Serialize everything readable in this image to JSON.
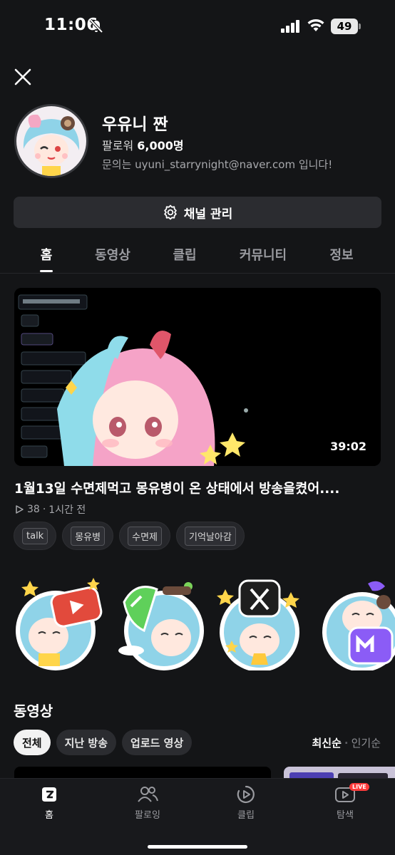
{
  "status_bar": {
    "time": "11:06",
    "battery": "49"
  },
  "channel": {
    "name": "우유니 짠",
    "followers_label": "팔로워",
    "followers_count": "6,000명",
    "inquiry": "문의는 uyuni_starrynight@naver.com 입니다!",
    "manage_button": "채널 관리"
  },
  "tabs": [
    {
      "label": "홈",
      "active": true
    },
    {
      "label": "동영상",
      "active": false
    },
    {
      "label": "클립",
      "active": false
    },
    {
      "label": "커뮤니티",
      "active": false
    },
    {
      "label": "정보",
      "active": false
    }
  ],
  "featured_video": {
    "duration": "39:02",
    "title": "1월13일 수면제먹고 몽유병이 온 상태에서 방송을켰어....",
    "views": "38",
    "time_ago": "1시간 전",
    "tags": [
      "talk",
      "몽유병",
      "수면제",
      "기억날아감"
    ]
  },
  "stickers": [
    {
      "icon": "youtube-sticker-icon",
      "color": "#e24a3c"
    },
    {
      "icon": "green-sticker-icon",
      "color": "#5fd05a"
    },
    {
      "icon": "x-sticker-icon",
      "color": "#1e1e1e"
    },
    {
      "icon": "purple-sticker-icon",
      "color": "#8b5cf6"
    }
  ],
  "videos_section": {
    "title": "동영상",
    "filters": [
      {
        "label": "전체",
        "active": true
      },
      {
        "label": "지난 방송",
        "active": false
      },
      {
        "label": "업로드 영상",
        "active": false
      }
    ],
    "sort_selected": "최신순",
    "sort_other": "인기순"
  },
  "bottom_nav": [
    {
      "label": "홈",
      "icon": "home-icon",
      "active": true
    },
    {
      "label": "팔로잉",
      "icon": "following-icon",
      "active": false
    },
    {
      "label": "클립",
      "icon": "clip-icon",
      "active": false
    },
    {
      "label": "탐색",
      "icon": "explore-icon",
      "active": false,
      "badge": "LIVE"
    }
  ],
  "colors": {
    "background": "#141517",
    "card": "#2b2c30",
    "live": "#ff3b3b"
  }
}
